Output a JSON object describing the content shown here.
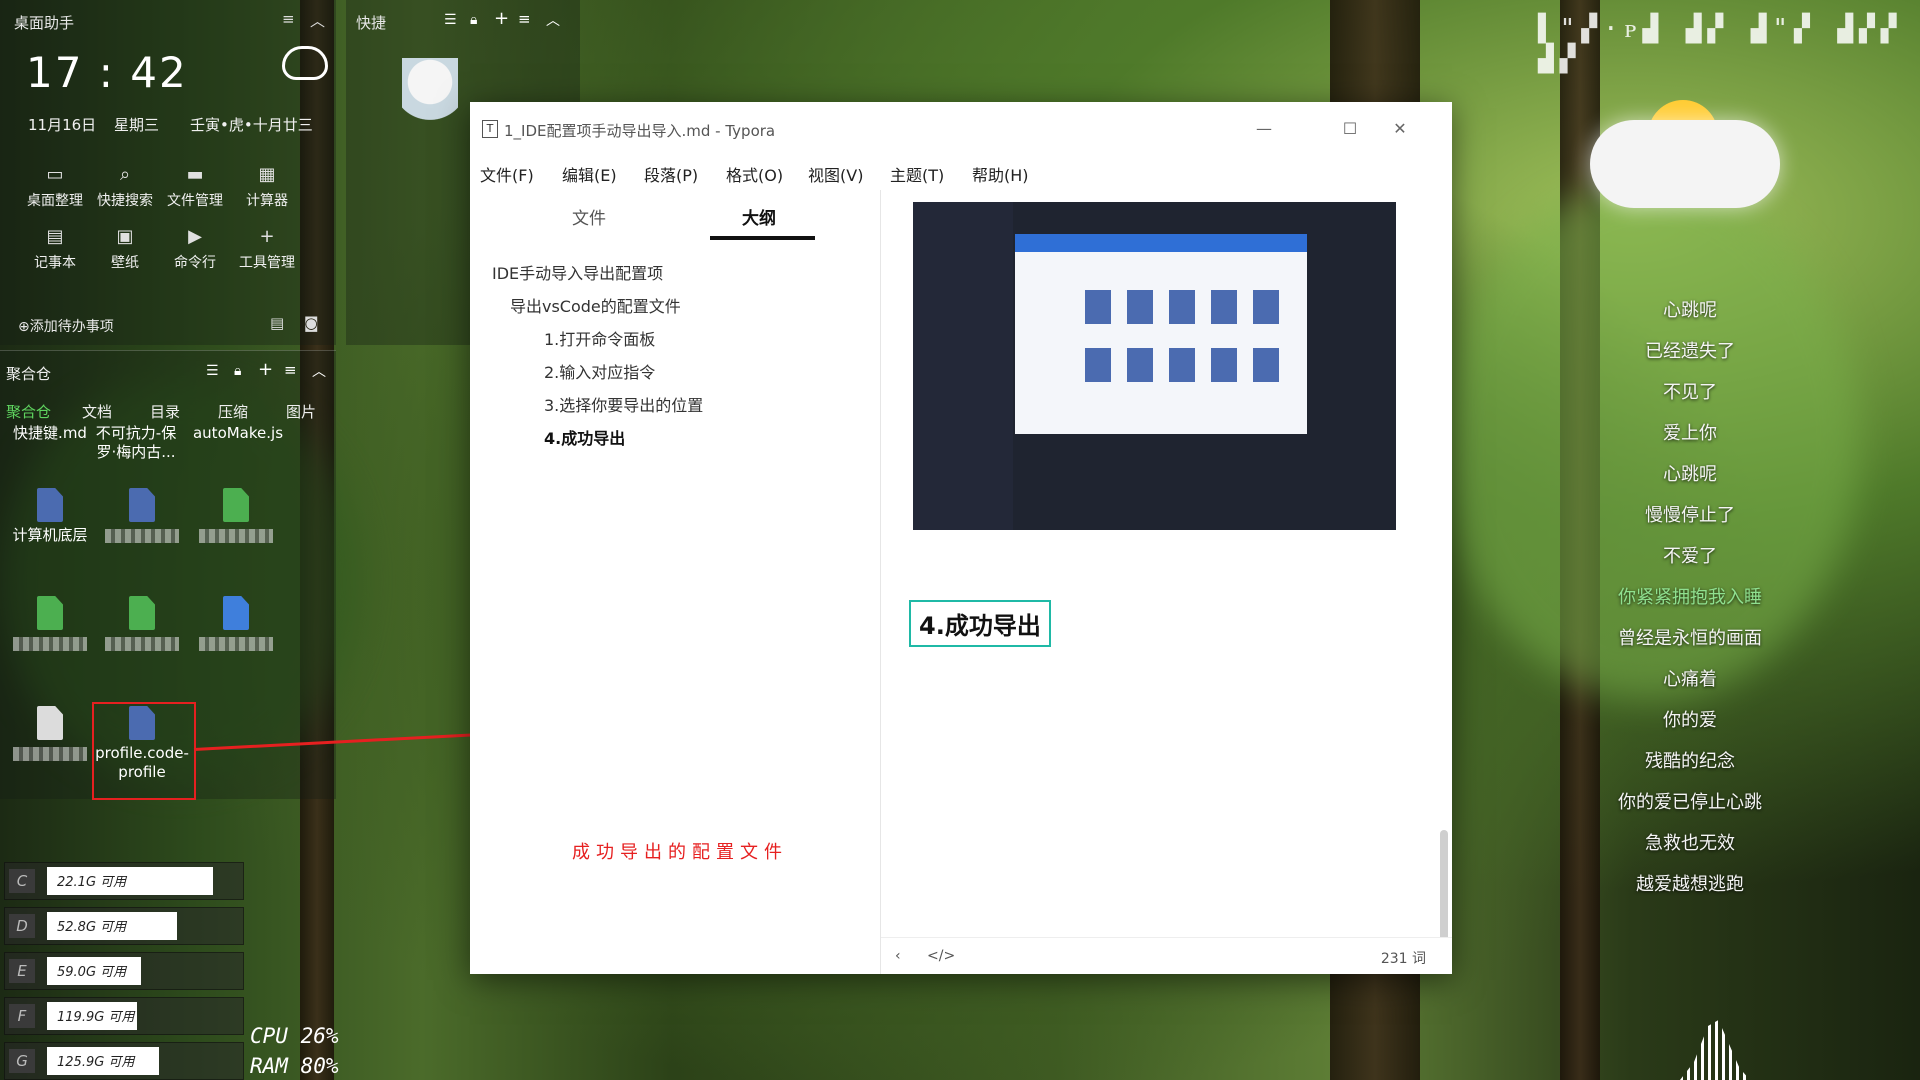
{
  "helper": {
    "title": "桌面助手",
    "time": "17 : 42",
    "date": "11月16日",
    "weekday": "星期三",
    "lunar": "壬寅•虎•十月廿三",
    "tools": [
      "桌面整理",
      "快捷搜索",
      "文件管理",
      "计算器",
      "记事本",
      "壁纸",
      "命令行",
      "工具管理"
    ],
    "todo_label": "⊕添加待办事项"
  },
  "quick": {
    "title": "快捷"
  },
  "fence": {
    "title": "聚合仓",
    "tabs": [
      "聚合仓",
      "文档",
      "目录",
      "压缩",
      "图片"
    ],
    "files_top": [
      "快捷键.md",
      "不可抗力-保罗·梅内古...",
      "autoMake.js"
    ],
    "files": [
      "计算机底层",
      "profile.code-profile"
    ]
  },
  "disks": [
    {
      "letter": "C",
      "text": "22.1G 可用",
      "fill": 0.7
    },
    {
      "letter": "D",
      "text": "52.8G 可用",
      "fill": 0.55
    },
    {
      "letter": "E",
      "text": "59.0G 可用",
      "fill": 0.4
    },
    {
      "letter": "F",
      "text": "119.9G 可用",
      "fill": 0.38
    },
    {
      "letter": "G",
      "text": "125.9G 可用",
      "fill": 0.47
    }
  ],
  "sysmon": {
    "cpu": "CPU   26%",
    "ram": "RAM   80%"
  },
  "window": {
    "title": "1_IDE配置项手动导出导入.md - Typora",
    "menu": [
      "文件(F)",
      "编辑(E)",
      "段落(P)",
      "格式(O)",
      "视图(V)",
      "主题(T)",
      "帮助(H)"
    ],
    "tabs": {
      "files": "文件",
      "outline": "大纲"
    },
    "outline": [
      "IDE手动导入导出配置项",
      "导出vsCode的配置文件",
      "1.打开命令面板",
      "2.输入对应指令",
      "3.选择你要导出的位置",
      "4.成功导出"
    ],
    "heading": "4.成功导出",
    "word_count": "231 词",
    "status_icons": [
      "chevron-left-icon",
      "code-icon"
    ]
  },
  "annotation": "成功导出的配置文件",
  "lyrics": [
    "心跳呢",
    "已经遗失了",
    "不见了",
    "爱上你",
    "心跳呢",
    "慢慢停止了",
    "不爱了",
    "你紧紧拥抱我入睡",
    "曾经是永恒的画面",
    "心痛着",
    "你的爱",
    "残酷的纪念",
    "你的爱已停止心跳",
    "急救也无效",
    "越爱越想逃跑"
  ]
}
